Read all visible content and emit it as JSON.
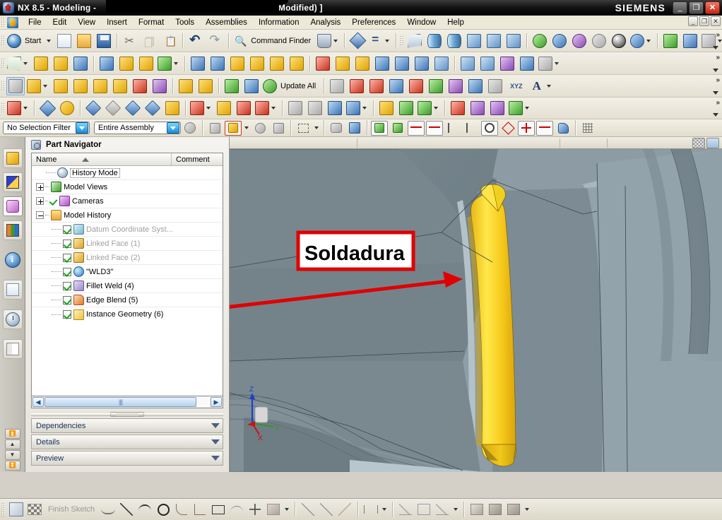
{
  "window": {
    "title_prefix": "NX 8.5 - Modeling - ",
    "title_suffix": "(Modified) ]",
    "brand": "SIEMENS",
    "app_icon": "nx-logo-icon",
    "buttons": [
      {
        "name": "minimize-button",
        "glyph": "_"
      },
      {
        "name": "restore-button",
        "glyph": "❐"
      },
      {
        "name": "close-button",
        "glyph": "✕"
      }
    ]
  },
  "menubar": {
    "app_icon": "nx-menu-icon",
    "items": [
      {
        "label": "File",
        "mnemonic": "F"
      },
      {
        "label": "Edit",
        "mnemonic": "E"
      },
      {
        "label": "View",
        "mnemonic": "V"
      },
      {
        "label": "Insert",
        "mnemonic": "s"
      },
      {
        "label": "Format",
        "mnemonic": "r"
      },
      {
        "label": "Tools",
        "mnemonic": "T"
      },
      {
        "label": "Assemblies",
        "mnemonic": "A"
      },
      {
        "label": "Information",
        "mnemonic": "I"
      },
      {
        "label": "Analysis",
        "mnemonic": "l"
      },
      {
        "label": "Preferences",
        "mnemonic": "P"
      },
      {
        "label": "Window",
        "mnemonic": "o"
      },
      {
        "label": "Help",
        "mnemonic": "H"
      }
    ],
    "doc_buttons": [
      {
        "name": "doc-minimize-button",
        "glyph": "_"
      },
      {
        "name": "doc-restore-button",
        "glyph": "❐"
      },
      {
        "name": "doc-close-button",
        "glyph": "✕"
      }
    ]
  },
  "toolbar": {
    "start_label": "Start",
    "command_finder_label": "Command Finder",
    "update_all_label": "Update All",
    "row1_icons": [
      "new-file-icon",
      "open-file-icon",
      "save-icon",
      "cut-icon",
      "copy-icon",
      "paste-icon",
      "undo-icon",
      "redo-icon",
      "command-finder-icon",
      "window-layout-icon",
      "info-window-icon",
      "expression-icon",
      "fit-view-icon",
      "zoom-icon",
      "zoom-window-icon",
      "pan-icon",
      "rotate-icon",
      "perspective-icon",
      "style-shaded-icon",
      "shaded-with-edges-icon",
      "wireframe-icon",
      "static-wireframe-icon",
      "true-shading-icon",
      "render-style-icon",
      "section-icon",
      "clip-icon",
      "view-orient-icon"
    ],
    "row2_icons": [
      "sketch-icon",
      "extrude-icon",
      "revolve-icon",
      "hole-icon",
      "datum-plane-icon",
      "shell-icon",
      "pattern-feature-icon",
      "unite-icon",
      "tube-icon",
      "swept-icon",
      "sphere-icon",
      "block-icon",
      "cone-icon",
      "draft-icon",
      "trim-body-icon",
      "split-body-icon",
      "offset-face-icon",
      "replace-face-icon",
      "delete-face-icon",
      "sew-icon",
      "thicken-icon",
      "bridge-curve-icon",
      "more-features-icon"
    ],
    "row3_icons": [
      "assembly-navigator-icon",
      "add-component-icon",
      "new-component-icon",
      "create-assembly-icon",
      "mirror-assembly-icon",
      "move-component-icon",
      "pattern-component-icon",
      "assembly-constraints-icon",
      "show-degrees-icon",
      "wave-geometry-linker-icon",
      "deformable-part-icon",
      "update-all-icon",
      "weld-point-icon",
      "arc-icon",
      "line-icon",
      "spline-icon",
      "intersect-icon",
      "sketch-curve-icon",
      "text-icon",
      "xyz-icon",
      "letter-a-icon"
    ],
    "row4_icons": [
      "wcs-dynamics-icon",
      "edit-object-display-icon",
      "object-color-icon",
      "show-hide-icon",
      "hide-icon",
      "show-only-icon",
      "invert-shown-icon",
      "show-all-icon",
      "reverse-blank-icon",
      "unblank-icon",
      "pattern-geometry-icon",
      "measure-distance-icon",
      "measure-angle-icon",
      "dim-linear-icon",
      "datum-axis-icon",
      "trapezoid-icon",
      "box-select-icon",
      "face-analysis-icon",
      "weld-icon",
      "curve-analysis-icon",
      "simple-hole-icon",
      "thread-icon",
      "pmi-note-icon",
      "annotation-icon",
      "symbol-icon"
    ]
  },
  "selection_bar": {
    "filter": {
      "value": "No Selection Filter",
      "name": "selection-filter-combo"
    },
    "scope": {
      "value": "Entire Assembly",
      "name": "selection-scope-combo"
    },
    "icons": [
      "keep-selected-icon",
      "up-one-level-icon",
      "select-feature-icon",
      "snap-point-icon",
      "reset-selection-icon",
      "highlight-hidden-icon",
      "rectangle-select-icon",
      "face-select-icon",
      "solid-body-select-icon",
      "enable-snap-point-icon",
      "point-on-curve-icon",
      "end-point-icon",
      "midpoint-icon",
      "control-point-icon",
      "intersection-point-icon",
      "arc-center-icon",
      "quadrant-point-icon",
      "existing-point-icon",
      "point-on-face-icon",
      "point-constructor-icon",
      "grid-icon"
    ]
  },
  "resource_bar": {
    "items": [
      {
        "name": "assembly-navigator-icon",
        "active": false
      },
      {
        "name": "constraint-navigator-icon",
        "active": false
      },
      {
        "name": "part-navigator-icon",
        "active": true
      },
      {
        "name": "reuse-library-icon",
        "active": false
      },
      {
        "name": "hd3d-tools-icon",
        "active": false
      },
      {
        "name": "web-browser-icon",
        "active": false
      },
      {
        "name": "history-icon",
        "active": false
      },
      {
        "name": "roles-icon",
        "active": false
      }
    ],
    "scroll_buttons": [
      "⏫",
      "▲",
      "▼",
      "⏬"
    ]
  },
  "part_navigator": {
    "title": "Part Navigator",
    "columns": [
      "Name",
      "Comment"
    ],
    "sort_indicator": "ascending",
    "rows": [
      {
        "label": "History Mode",
        "icon": "clock-icon",
        "indent": 1,
        "expander": "none",
        "checkbox": false,
        "dimmed": false,
        "boxed": true
      },
      {
        "label": "Model Views",
        "icon": "model-views-icon",
        "indent": 0,
        "expander": "plus",
        "checkbox": false,
        "dimmed": false,
        "boxed": false
      },
      {
        "label": "Cameras",
        "icon": "camera-icon",
        "indent": 0,
        "expander": "plus",
        "checkbox": false,
        "dimmed": false,
        "boxed": false,
        "check_mark": true
      },
      {
        "label": "Model History",
        "icon": "folder-icon",
        "indent": 0,
        "expander": "minus",
        "checkbox": false,
        "dimmed": false,
        "boxed": false
      },
      {
        "label": "Datum Coordinate Syst...",
        "icon": "datum-csys-icon",
        "indent": 2,
        "expander": "none",
        "checkbox": true,
        "dimmed": true,
        "boxed": false
      },
      {
        "label": "Linked Face (1)",
        "icon": "linked-face-icon",
        "indent": 2,
        "expander": "none",
        "checkbox": true,
        "dimmed": true,
        "boxed": false
      },
      {
        "label": "Linked Face (2)",
        "icon": "linked-face-icon",
        "indent": 2,
        "expander": "none",
        "checkbox": true,
        "dimmed": true,
        "boxed": false
      },
      {
        "label": "\"WLD3\"",
        "icon": "wld-icon",
        "indent": 2,
        "expander": "none",
        "checkbox": true,
        "dimmed": false,
        "boxed": false
      },
      {
        "label": "Fillet Weld (4)",
        "icon": "fillet-weld-icon",
        "indent": 2,
        "expander": "none",
        "checkbox": true,
        "dimmed": false,
        "boxed": false
      },
      {
        "label": "Edge Blend (5)",
        "icon": "edge-blend-icon",
        "indent": 2,
        "expander": "none",
        "checkbox": true,
        "dimmed": false,
        "boxed": false
      },
      {
        "label": "Instance Geometry (6)",
        "icon": "instance-geom-icon",
        "indent": 2,
        "expander": "none",
        "checkbox": true,
        "dimmed": false,
        "boxed": false
      }
    ],
    "scrollbar": {
      "left_arrow": "◀",
      "right_arrow": "▶",
      "grip": "||||"
    },
    "accordion": [
      {
        "label": "Dependencies",
        "name": "dependencies-section"
      },
      {
        "label": "Details",
        "name": "details-section"
      },
      {
        "label": "Preview",
        "name": "preview-section"
      }
    ]
  },
  "viewport": {
    "annotation": {
      "text": "Soldadura",
      "border_color": "#e00000",
      "fill_color": "#ffffff",
      "arrow_color": "#e00000"
    },
    "triad": {
      "z_label": "Z",
      "y_label": "Y",
      "x_label": "X",
      "z_color": "#1c3fd0",
      "y_color": "#2a9a2a",
      "x_color": "#cc1111"
    },
    "colors": {
      "background": "#8f9ea6",
      "weld_highlight": "#f5cf1a",
      "body_face": "#78868c",
      "body_face_light": "#9fb0b8"
    },
    "top_buttons": [
      "render-mode-icon",
      "full-screen-icon"
    ]
  },
  "statusbar": {
    "finish_sketch_label": "Finish Sketch",
    "icons": [
      "sketch-in-task-icon",
      "finish-sketch-flag-icon",
      "profile-icon",
      "line-icon",
      "arc-icon",
      "circle-icon",
      "fillet-icon",
      "chamfer-icon",
      "rectangle-icon",
      "studio-spline-icon",
      "point-icon",
      "offset-curve-icon",
      "quick-trim-icon",
      "quick-extend-icon",
      "make-corner-icon",
      "rapid-dimension-icon",
      "geometric-constraints-icon",
      "make-symmetric-icon",
      "display-constraints-icon",
      "sketch-preferences-icon",
      "project-curve-icon",
      "intersection-curve-icon"
    ]
  }
}
